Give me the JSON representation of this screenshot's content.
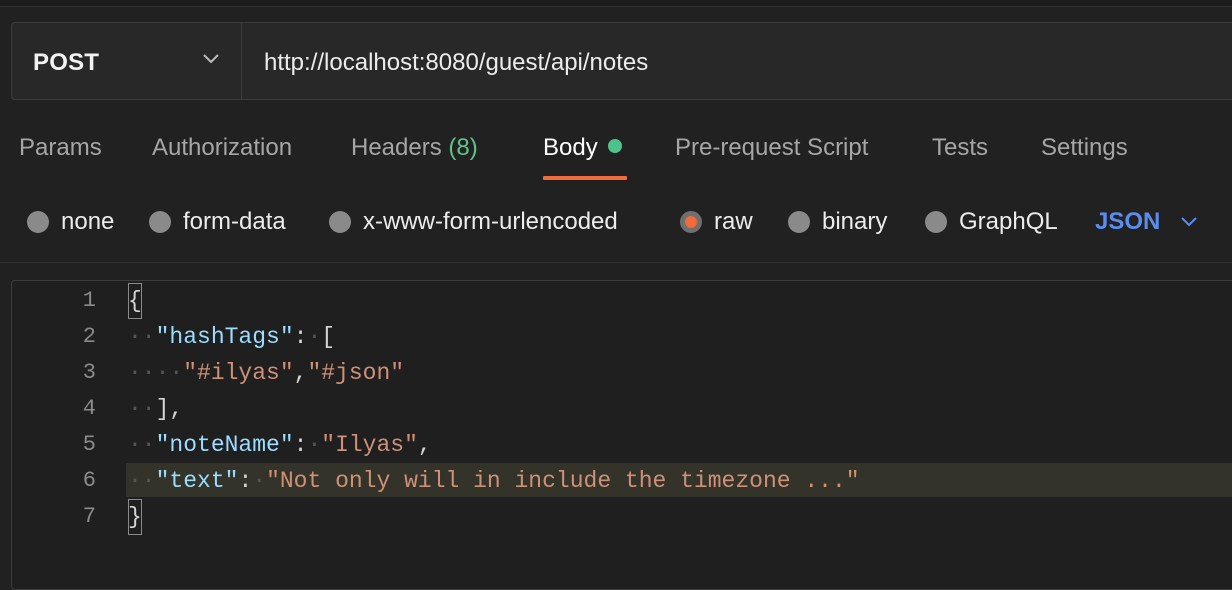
{
  "request": {
    "method": "POST",
    "url": "http://localhost:8080/guest/api/notes"
  },
  "tabs": {
    "params": "Params",
    "authorization": "Authorization",
    "headers": "Headers",
    "headers_count": "(8)",
    "body": "Body",
    "prerequest": "Pre-request Script",
    "tests": "Tests",
    "settings": "Settings",
    "active": "Body"
  },
  "body_types": {
    "none": "none",
    "form_data": "form-data",
    "urlencoded": "x-www-form-urlencoded",
    "raw": "raw",
    "binary": "binary",
    "graphql": "GraphQL",
    "selected": "raw",
    "language": "JSON"
  },
  "editor": {
    "line_numbers": [
      "1",
      "2",
      "3",
      "4",
      "5",
      "6",
      "7"
    ],
    "highlighted_line": "6",
    "tokens": {
      "open_brace": "{",
      "key_hashtags": "\"hashTags\"",
      "colon": ":",
      "open_bracket": "[",
      "tag1": "\"#ilyas\"",
      "comma": ",",
      "tag2": "\"#json\"",
      "close_bracket": "],",
      "key_notename": "\"noteName\"",
      "val_notename": "\"Ilyas\"",
      "key_text": "\"text\"",
      "val_text": "\"Not only will in include the timezone ...\"",
      "close_brace": "}"
    }
  },
  "colors": {
    "accent": "#f26b3a",
    "status_dot": "#4cc38a",
    "json_label": "#5b8dee",
    "json_key": "#9cdcfe",
    "json_string": "#ce9178"
  }
}
